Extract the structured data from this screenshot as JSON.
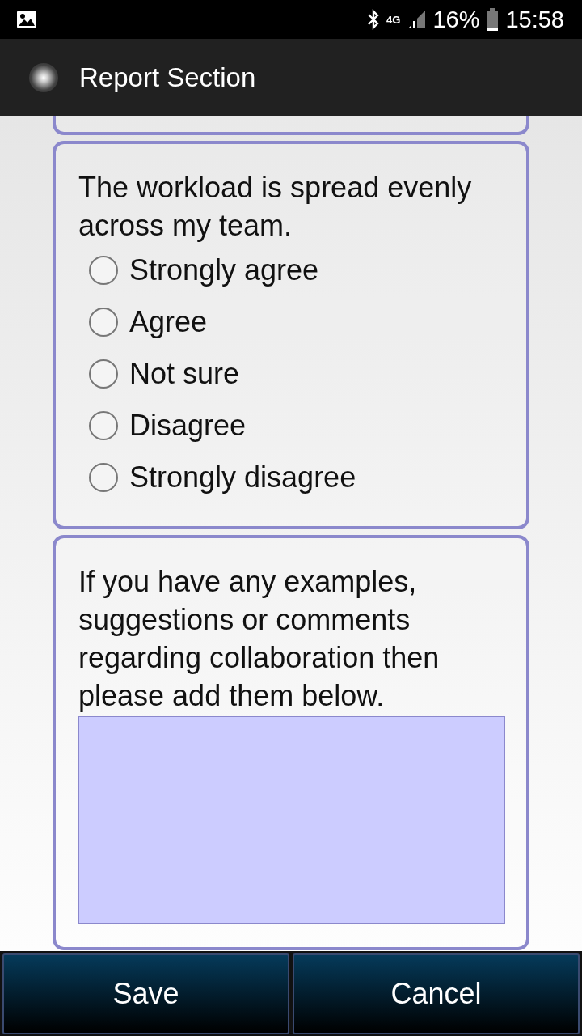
{
  "status_bar": {
    "network": "4G",
    "battery": "16%",
    "time": "15:58"
  },
  "app_bar": {
    "title": "Report Section"
  },
  "questions": [
    {
      "kind": "radio",
      "text": "The workload is spread evenly across my team.",
      "options": [
        {
          "label": "Strongly agree",
          "selected": false
        },
        {
          "label": "Agree",
          "selected": false
        },
        {
          "label": "Not sure",
          "selected": false
        },
        {
          "label": "Disagree",
          "selected": false
        },
        {
          "label": "Strongly disagree",
          "selected": false
        }
      ]
    },
    {
      "kind": "text",
      "text": "If you have any examples, suggestions or comments regarding collaboration then please add them below."
    }
  ],
  "buttons": [
    "Save",
    "Cancel"
  ]
}
